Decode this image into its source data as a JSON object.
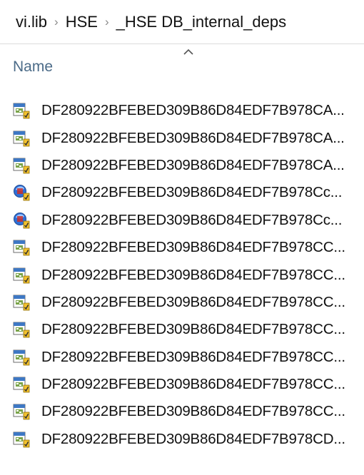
{
  "breadcrumb": {
    "items": [
      "vi.lib",
      "HSE",
      "_HSE DB_internal_deps"
    ],
    "separator": "›"
  },
  "columns": {
    "name_header": "Name",
    "sort_icon": "chevron-up-icon"
  },
  "files": [
    {
      "name": "DF280922BFEBED309B86D84EDF7B978CA...",
      "icon": "vi-file-icon"
    },
    {
      "name": "DF280922BFEBED309B86D84EDF7B978CA...",
      "icon": "vi-file-icon"
    },
    {
      "name": "DF280922BFEBED309B86D84EDF7B978CA...",
      "icon": "vi-file-icon"
    },
    {
      "name": "DF280922BFEBED309B86D84EDF7B978Cc...",
      "icon": "ctl-file-icon"
    },
    {
      "name": "DF280922BFEBED309B86D84EDF7B978Cc...",
      "icon": "ctl-file-icon"
    },
    {
      "name": "DF280922BFEBED309B86D84EDF7B978CC...",
      "icon": "vi-file-icon"
    },
    {
      "name": "DF280922BFEBED309B86D84EDF7B978CC...",
      "icon": "vi-file-icon"
    },
    {
      "name": "DF280922BFEBED309B86D84EDF7B978CC...",
      "icon": "vi-file-icon"
    },
    {
      "name": "DF280922BFEBED309B86D84EDF7B978CC...",
      "icon": "vi-file-icon"
    },
    {
      "name": "DF280922BFEBED309B86D84EDF7B978CC...",
      "icon": "vi-file-icon"
    },
    {
      "name": "DF280922BFEBED309B86D84EDF7B978CC...",
      "icon": "vi-file-icon"
    },
    {
      "name": "DF280922BFEBED309B86D84EDF7B978CC...",
      "icon": "vi-file-icon"
    },
    {
      "name": "DF280922BFEBED309B86D84EDF7B978CD...",
      "icon": "vi-file-icon"
    }
  ],
  "colors": {
    "header_text": "#4b6b88",
    "icon_accent": "#f2c12e",
    "icon_blue": "#2f6fd6"
  }
}
